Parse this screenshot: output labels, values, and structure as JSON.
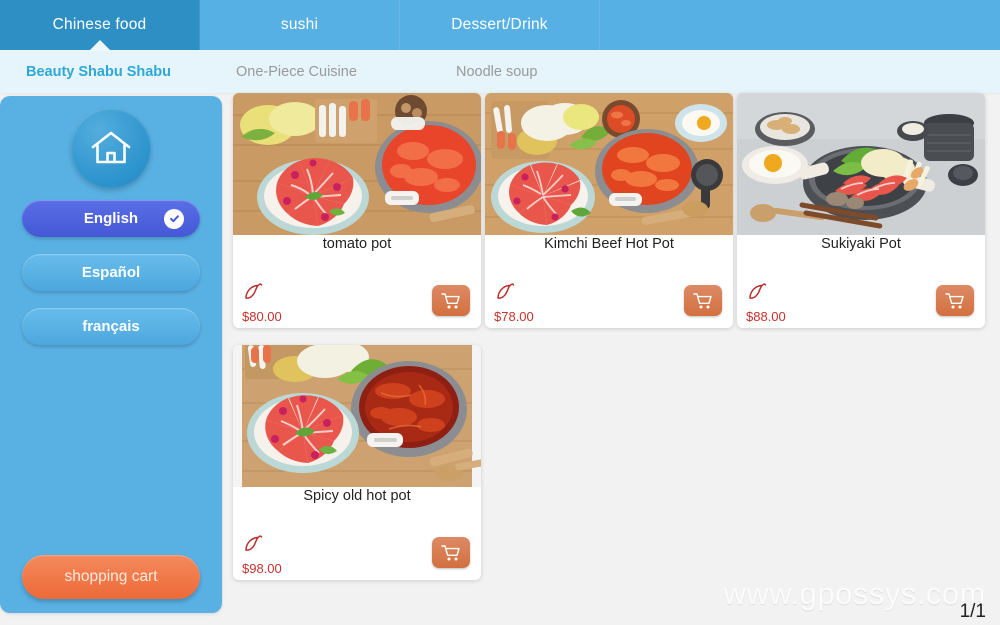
{
  "top_tabs": [
    {
      "label": "Chinese food",
      "active": true
    },
    {
      "label": "sushi",
      "active": false
    },
    {
      "label": "Dessert/Drink",
      "active": false
    }
  ],
  "sub_tabs": [
    {
      "label": "Beauty Shabu Shabu",
      "active": true
    },
    {
      "label": "One-Piece Cuisine",
      "active": false
    },
    {
      "label": "Noodle soup",
      "active": false
    }
  ],
  "sidebar": {
    "home_icon": "home-icon",
    "languages": [
      {
        "label": "English",
        "selected": true
      },
      {
        "label": "Español",
        "selected": false
      },
      {
        "label": "français",
        "selected": false
      }
    ],
    "cart_label": "shopping cart"
  },
  "products": [
    {
      "name": "tomato pot",
      "price": "$80.00",
      "spicy_icon": "chili-pepper-icon",
      "cart_icon": "shopping-cart-icon",
      "image": "tomato-hotpot-photo"
    },
    {
      "name": "Kimchi Beef Hot Pot",
      "price": "$78.00",
      "spicy_icon": "chili-pepper-icon",
      "cart_icon": "shopping-cart-icon",
      "image": "kimchi-beef-hotpot-photo"
    },
    {
      "name": "Sukiyaki Pot",
      "price": "$88.00",
      "spicy_icon": "chili-pepper-icon",
      "cart_icon": "shopping-cart-icon",
      "image": "sukiyaki-pot-photo"
    },
    {
      "name": "Spicy old hot pot",
      "price": "$98.00",
      "spicy_icon": "chili-pepper-icon",
      "cart_icon": "shopping-cart-icon",
      "image": "spicy-old-hotpot-photo"
    }
  ],
  "footer": {
    "watermark": "www.gpossys.com",
    "page_indicator": "1/1"
  },
  "colors": {
    "tab_active": "#2e8fc4",
    "tab_inactive": "#56b0e3",
    "subbar_bg": "#e6f4fc",
    "subtab_active": "#2fa8d8",
    "sidebar_bg": "#59b0e3",
    "lang_selected": "#4558d6",
    "cart_orange": "#ed6a37",
    "price_red": "#c8322e"
  }
}
